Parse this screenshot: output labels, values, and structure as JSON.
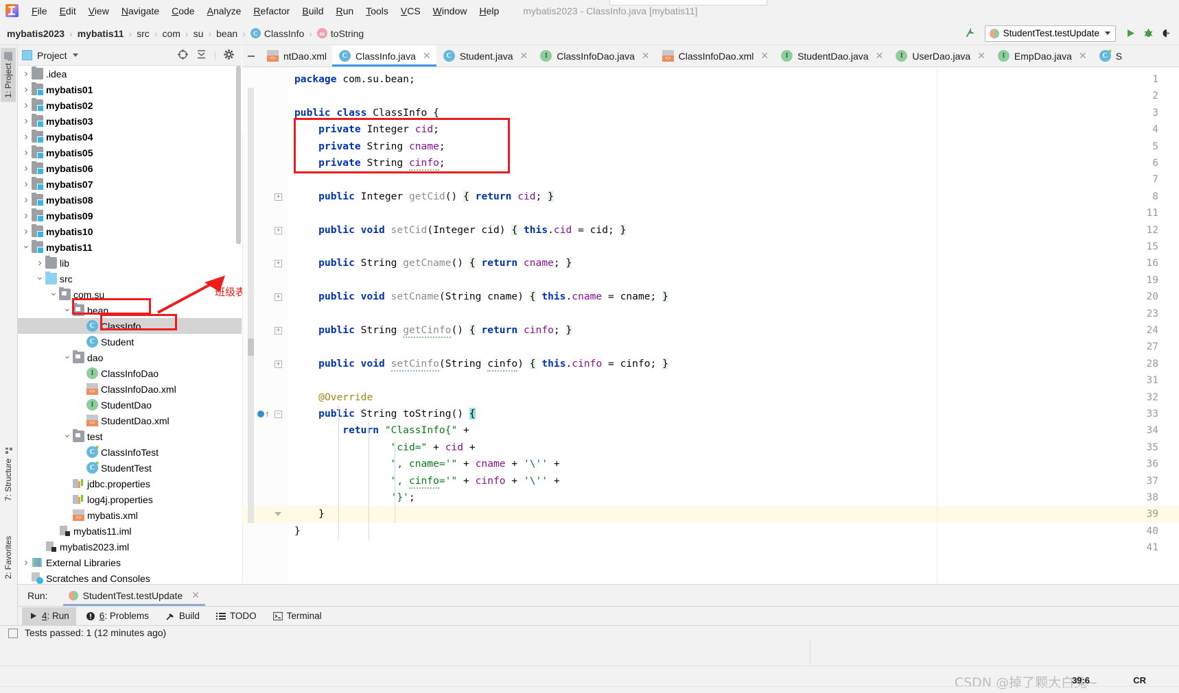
{
  "window": {
    "title": "mybatis2023 - ClassInfo.java [mybatis11]"
  },
  "menubar": {
    "items": [
      {
        "label": "File"
      },
      {
        "label": "Edit"
      },
      {
        "label": "View"
      },
      {
        "label": "Navigate"
      },
      {
        "label": "Code"
      },
      {
        "label": "Analyze"
      },
      {
        "label": "Refactor"
      },
      {
        "label": "Build"
      },
      {
        "label": "Run"
      },
      {
        "label": "Tools"
      },
      {
        "label": "VCS"
      },
      {
        "label": "Window"
      },
      {
        "label": "Help"
      }
    ]
  },
  "breadcrumb": {
    "items": [
      {
        "label": "mybatis2023",
        "bold": true,
        "icon": ""
      },
      {
        "label": "mybatis11",
        "bold": true,
        "icon": ""
      },
      {
        "label": "src",
        "bold": false,
        "icon": ""
      },
      {
        "label": "com",
        "bold": false,
        "icon": ""
      },
      {
        "label": "su",
        "bold": false,
        "icon": ""
      },
      {
        "label": "bean",
        "bold": false,
        "icon": ""
      },
      {
        "label": "ClassInfo",
        "bold": false,
        "icon": "class-icon",
        "badge": "C"
      },
      {
        "label": "toString",
        "bold": false,
        "icon": "method-icon",
        "badge": "m"
      }
    ]
  },
  "run_config": {
    "name": "StudentTest.testUpdate",
    "run_label": "Run",
    "debug_label": "Debug",
    "coverage_label": "Run with Coverage"
  },
  "left_tool_strip": {
    "project": "1: Project",
    "structure": "7: Structure",
    "favorites": "2: Favorites"
  },
  "project_panel": {
    "title": "Project",
    "tree": [
      {
        "depth": 1,
        "twisty": "right",
        "icon": "folder-icon",
        "label": ".idea",
        "bold": false
      },
      {
        "depth": 1,
        "twisty": "right",
        "icon": "module-icon",
        "label": "mybatis01",
        "bold": true
      },
      {
        "depth": 1,
        "twisty": "right",
        "icon": "module-icon",
        "label": "mybatis02",
        "bold": true
      },
      {
        "depth": 1,
        "twisty": "right",
        "icon": "module-icon",
        "label": "mybatis03",
        "bold": true
      },
      {
        "depth": 1,
        "twisty": "right",
        "icon": "module-icon",
        "label": "mybatis04",
        "bold": true
      },
      {
        "depth": 1,
        "twisty": "right",
        "icon": "module-icon",
        "label": "mybatis05",
        "bold": true
      },
      {
        "depth": 1,
        "twisty": "right",
        "icon": "module-icon",
        "label": "mybatis06",
        "bold": true
      },
      {
        "depth": 1,
        "twisty": "right",
        "icon": "module-icon",
        "label": "mybatis07",
        "bold": true
      },
      {
        "depth": 1,
        "twisty": "right",
        "icon": "module-icon",
        "label": "mybatis08",
        "bold": true
      },
      {
        "depth": 1,
        "twisty": "right",
        "icon": "module-icon",
        "label": "mybatis09",
        "bold": true
      },
      {
        "depth": 1,
        "twisty": "right",
        "icon": "module-icon",
        "label": "mybatis10",
        "bold": true
      },
      {
        "depth": 1,
        "twisty": "down",
        "icon": "module-icon",
        "label": "mybatis11",
        "bold": true
      },
      {
        "depth": 2,
        "twisty": "right",
        "icon": "folder-icon",
        "label": "lib",
        "bold": false
      },
      {
        "depth": 2,
        "twisty": "down",
        "icon": "source-folder-icon",
        "label": "src",
        "bold": false
      },
      {
        "depth": 3,
        "twisty": "down",
        "icon": "package-icon",
        "label": "com.su",
        "bold": false
      },
      {
        "depth": 4,
        "twisty": "down",
        "icon": "package-icon",
        "label": "bean",
        "bold": false
      },
      {
        "depth": 5,
        "twisty": "none",
        "icon": "class-icon",
        "badge": "C",
        "label": "ClassInfo",
        "bold": false,
        "selected": true
      },
      {
        "depth": 5,
        "twisty": "none",
        "icon": "class-icon",
        "badge": "C",
        "label": "Student",
        "bold": false
      },
      {
        "depth": 4,
        "twisty": "down",
        "icon": "package-icon",
        "label": "dao",
        "bold": false
      },
      {
        "depth": 5,
        "twisty": "none",
        "icon": "interface-icon",
        "badge": "I",
        "label": "ClassInfoDao",
        "bold": false
      },
      {
        "depth": 5,
        "twisty": "none",
        "icon": "xml-icon",
        "label": "ClassInfoDao.xml",
        "bold": false
      },
      {
        "depth": 5,
        "twisty": "none",
        "icon": "interface-icon",
        "badge": "I",
        "label": "StudentDao",
        "bold": false
      },
      {
        "depth": 5,
        "twisty": "none",
        "icon": "xml-icon",
        "label": "StudentDao.xml",
        "bold": false
      },
      {
        "depth": 4,
        "twisty": "down",
        "icon": "package-icon",
        "label": "test",
        "bold": false
      },
      {
        "depth": 5,
        "twisty": "none",
        "icon": "test-class-icon",
        "badge": "C",
        "label": "ClassInfoTest",
        "bold": false
      },
      {
        "depth": 5,
        "twisty": "none",
        "icon": "test-class-icon",
        "badge": "C",
        "label": "StudentTest",
        "bold": false
      },
      {
        "depth": 4,
        "twisty": "none",
        "icon": "properties-icon",
        "label": "jdbc.properties",
        "bold": false
      },
      {
        "depth": 4,
        "twisty": "none",
        "icon": "properties-icon",
        "label": "log4j.properties",
        "bold": false
      },
      {
        "depth": 4,
        "twisty": "none",
        "icon": "xml-icon",
        "label": "mybatis.xml",
        "bold": false
      },
      {
        "depth": 3,
        "twisty": "none",
        "icon": "iml-icon",
        "label": "mybatis11.iml",
        "bold": false
      },
      {
        "depth": 2,
        "twisty": "none",
        "icon": "iml-icon",
        "label": "mybatis2023.iml",
        "bold": false
      },
      {
        "depth": 1,
        "twisty": "right",
        "icon": "library-icon",
        "label": "External Libraries",
        "bold": false
      },
      {
        "depth": 1,
        "twisty": "none",
        "icon": "scratch-icon",
        "label": "Scratches and Consoles",
        "bold": false
      }
    ]
  },
  "annotation": {
    "text": "班级表的实体类"
  },
  "editor_tabs": [
    {
      "label": "ntDao.xml",
      "icon": "xml-icon",
      "active": false,
      "truncated": true
    },
    {
      "label": "ClassInfo.java",
      "icon": "class-icon",
      "badge": "C",
      "active": true
    },
    {
      "label": "Student.java",
      "icon": "class-icon",
      "badge": "C",
      "active": false
    },
    {
      "label": "ClassInfoDao.java",
      "icon": "interface-icon",
      "badge": "I",
      "active": false
    },
    {
      "label": "ClassInfoDao.xml",
      "icon": "xml-icon",
      "active": false
    },
    {
      "label": "StudentDao.java",
      "icon": "interface-icon",
      "badge": "I",
      "active": false
    },
    {
      "label": "UserDao.java",
      "icon": "interface-icon",
      "badge": "I",
      "active": false
    },
    {
      "label": "EmpDao.java",
      "icon": "interface-icon",
      "badge": "I",
      "active": false
    },
    {
      "label": "S",
      "icon": "test-class-icon",
      "badge": "C",
      "active": false,
      "truncated": true
    }
  ],
  "code": {
    "lines": [
      {
        "num": "1",
        "fold": false,
        "html": "<span class=\"kw\">package</span> <span class=\"plain\">com.su.bean;</span>"
      },
      {
        "num": "2",
        "fold": false,
        "html": ""
      },
      {
        "num": "3",
        "fold": false,
        "html": "<span class=\"kw\">public class</span> <span class=\"plain\">ClassInfo {</span>"
      },
      {
        "num": "4",
        "fold": false,
        "html": "    <span class=\"kw\">private</span> <span class=\"plain\">Integer</span> <span class=\"fld\">cid</span><span class=\"plain\">;</span>"
      },
      {
        "num": "5",
        "fold": false,
        "html": "    <span class=\"kw\">private</span> <span class=\"plain\">String</span> <span class=\"fld\">cname</span><span class=\"plain\">;</span>"
      },
      {
        "num": "6",
        "fold": false,
        "html": "    <span class=\"kw\">private</span> <span class=\"plain\">String</span> <span class=\"fld wavy\">cinfo</span><span class=\"plain\">;</span>"
      },
      {
        "num": "7",
        "fold": false,
        "html": ""
      },
      {
        "num": "8",
        "fold": true,
        "html": "    <span class=\"kw\">public</span> <span class=\"plain\">Integer</span> <span class=\"mth\">getCid</span><span class=\"plain\">()</span> <span class=\"brace-hl\">{</span> <span class=\"kw\">return</span> <span class=\"fld\">cid</span><span class=\"plain\">;</span> <span class=\"brace-hl\">}</span>"
      },
      {
        "num": "11",
        "fold": false,
        "html": ""
      },
      {
        "num": "12",
        "fold": true,
        "html": "    <span class=\"kw\">public</span> <span class=\"kw\">void</span> <span class=\"mth\">setCid</span><span class=\"plain\">(Integer cid)</span> <span class=\"brace-hl\">{</span> <span class=\"kw\">this</span><span class=\"plain\">.</span><span class=\"fld\">cid</span> <span class=\"plain\">= cid;</span> <span class=\"brace-hl\">}</span>"
      },
      {
        "num": "15",
        "fold": false,
        "html": ""
      },
      {
        "num": "16",
        "fold": true,
        "html": "    <span class=\"kw\">public</span> <span class=\"plain\">String</span> <span class=\"mth\">getCname</span><span class=\"plain\">()</span> <span class=\"brace-hl\">{</span> <span class=\"kw\">return</span> <span class=\"fld\">cname</span><span class=\"plain\">;</span> <span class=\"brace-hl\">}</span>"
      },
      {
        "num": "19",
        "fold": false,
        "html": ""
      },
      {
        "num": "20",
        "fold": true,
        "html": "    <span class=\"kw\">public</span> <span class=\"kw\">void</span> <span class=\"mth\">setCname</span><span class=\"plain\">(String cname)</span> <span class=\"brace-hl\">{</span> <span class=\"kw\">this</span><span class=\"plain\">.</span><span class=\"fld\">cname</span> <span class=\"plain\">= cname;</span> <span class=\"brace-hl\">}</span>"
      },
      {
        "num": "23",
        "fold": false,
        "html": ""
      },
      {
        "num": "24",
        "fold": true,
        "html": "    <span class=\"kw\">public</span> <span class=\"plain\">String</span> <span class=\"mth wavy\">getCinfo</span><span class=\"plain\">()</span> <span class=\"brace-hl\">{</span> <span class=\"kw\">return</span> <span class=\"fld\">cinfo</span><span class=\"plain\">;</span> <span class=\"brace-hl\">}</span>"
      },
      {
        "num": "27",
        "fold": false,
        "html": ""
      },
      {
        "num": "28",
        "fold": true,
        "html": "    <span class=\"kw\">public</span> <span class=\"kw\">void</span> <span class=\"mth wavy\">setCinfo</span><span class=\"plain\">(String </span><span class=\"plain wavy\">cinfo</span><span class=\"plain\">)</span> <span class=\"brace-hl\">{</span> <span class=\"kw\">this</span><span class=\"plain\">.</span><span class=\"fld\">cinfo</span> <span class=\"plain\">= cinfo;</span> <span class=\"brace-hl\">}</span>"
      },
      {
        "num": "31",
        "fold": false,
        "html": ""
      },
      {
        "num": "32",
        "fold": false,
        "html": "    <span class=\"anno\">@Override</span>"
      },
      {
        "num": "33",
        "fold": "minus",
        "bp": true,
        "html": "    <span class=\"kw\">public</span> <span class=\"plain\">String</span> <span class=\"plain\">toString()</span> <span class=\"brace-cy\">{</span>"
      },
      {
        "num": "34",
        "fold": false,
        "html": "        <span class=\"kw\">return</span> <span class=\"str\">\"ClassInfo{\"</span> <span class=\"plain\">+</span>"
      },
      {
        "num": "35",
        "fold": false,
        "html": "                <span class=\"str\">\"cid=\"</span> <span class=\"plain\">+</span> <span class=\"fld\">cid</span> <span class=\"plain\">+</span>"
      },
      {
        "num": "36",
        "fold": false,
        "html": "                <span class=\"str\">\", cname='\"</span> <span class=\"plain\">+</span> <span class=\"fld\">cname</span> <span class=\"plain\">+</span> <span class=\"str\">'\\''</span> <span class=\"plain\">+</span>"
      },
      {
        "num": "37",
        "fold": false,
        "html": "                <span class=\"str\">\", </span><span class=\"str wavy\">cinfo</span><span class=\"str\">='\"</span> <span class=\"plain\">+</span> <span class=\"fld\">cinfo</span> <span class=\"plain\">+</span> <span class=\"str\">'\\''</span> <span class=\"plain\">+</span>"
      },
      {
        "num": "38",
        "fold": false,
        "html": "                <span class=\"str\">'}'</span><span class=\"plain\">;</span>"
      },
      {
        "num": "39",
        "fold": "end",
        "caret": true,
        "html": "    <span class=\"plain\">}</span>"
      },
      {
        "num": "40",
        "fold": false,
        "html": "<span class=\"plain\">}</span>"
      },
      {
        "num": "41",
        "fold": false,
        "html": ""
      }
    ]
  },
  "run_toolwindow": {
    "label": "Run:",
    "tab": "StudentTest.testUpdate"
  },
  "bottom_bar": {
    "items": [
      {
        "label": "4: Run",
        "underline": "4",
        "icon": "play-icon",
        "selected": true
      },
      {
        "label": "6: Problems",
        "underline": "6",
        "icon": "error-icon",
        "selected": false
      },
      {
        "label": "Build",
        "icon": "hammer-icon",
        "selected": false
      },
      {
        "label": "TODO",
        "icon": "list-icon",
        "selected": false
      },
      {
        "label": "Terminal",
        "icon": "terminal-icon",
        "selected": false
      }
    ]
  },
  "statusbar": {
    "message": "Tests passed: 1 (12 minutes ago)",
    "caret_position": "39:6",
    "encoding": "CR",
    "watermark": "CSDN @掉了颗大白兔~"
  },
  "colors": {
    "accent": "#3d9ae8",
    "annotation_red": "#ee1d1d",
    "keyword_blue": "#0033b3",
    "string_green": "#067d17",
    "field_purple": "#871094",
    "method_gray": "#8c8c8c"
  }
}
